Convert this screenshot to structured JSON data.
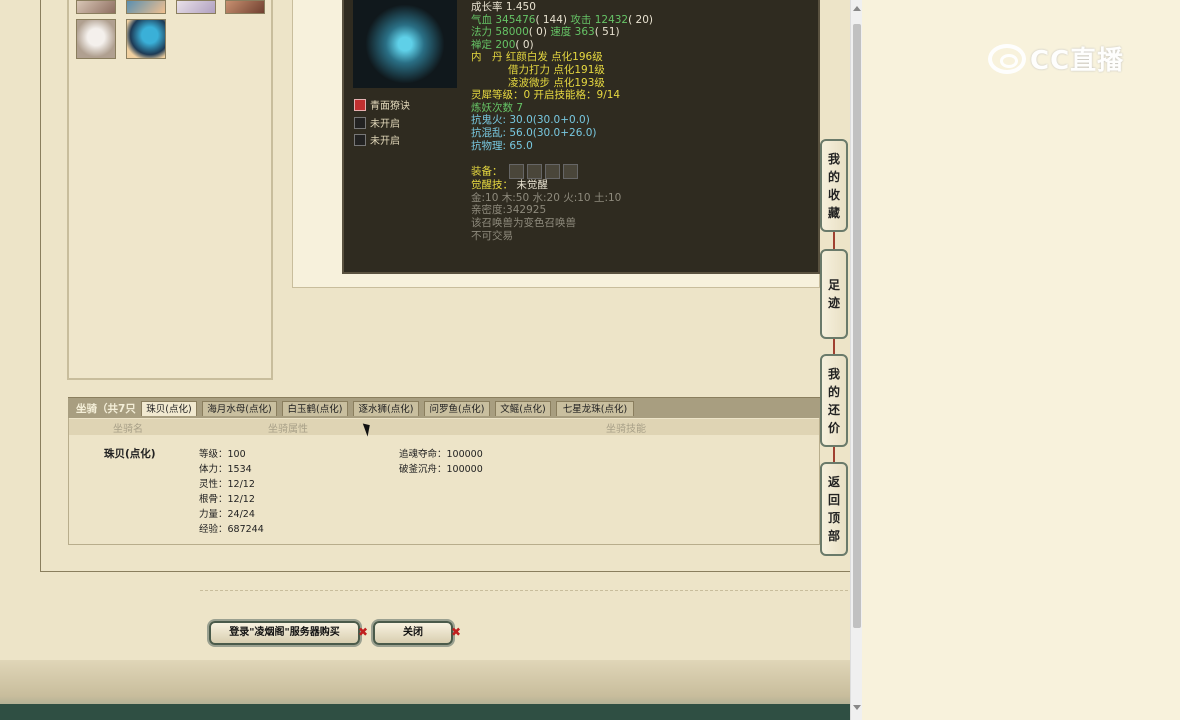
{
  "pet": {
    "stats": {
      "growth": "成长率 1.450",
      "hp_label": "气血",
      "hp_value": "345476",
      "hp_extra": "( 144)",
      "atk_label": "攻击",
      "atk_value": "12432",
      "atk_extra": "( 20)",
      "mp_label": "法力",
      "mp_value": "58000",
      "mp_extra": "( 0)",
      "spd_label": "速度",
      "spd_value": "363",
      "spd_extra": "( 51)",
      "def_label": "禅定",
      "def_value": "200",
      "def_extra": "( 0)",
      "neidan_label": "内　丹",
      "neidan1": "红颜白发 点化196级",
      "neidan2": "借力打力 点化191级",
      "neidan3": "凌波微步 点化193级",
      "lingxi": "灵犀等级：0 开启技能格：9/14",
      "lianyao": "炼妖次数 7",
      "kanghuo": "抗鬼火: 30.0(30.0+0.0)",
      "kanghunluan": "抗混乱: 56.0(30.0+26.0)",
      "kangwuli": "抗物理: 65.0",
      "equip_label": "装备：",
      "awaken_label": "觉醒技：",
      "awaken_value": "未觉醒",
      "elements": "金:10 木:50 水:20 火:10 土:10",
      "intimacy": "亲密度:342925",
      "bianse": "该召唤兽为变色召唤兽",
      "tradable": "不可交易"
    },
    "skills": [
      {
        "label": "青面獠诀"
      },
      {
        "label": "未开启"
      },
      {
        "label": "未开启"
      }
    ]
  },
  "mount": {
    "title": "坐骑（共7只",
    "tabs": [
      "珠贝(点化)",
      "海月水母(点化)",
      "白玉鹤(点化)",
      "逐水狮(点化)",
      "问罗鱼(点化)",
      "文鳐(点化)",
      "七星龙珠(点化)"
    ],
    "headers": {
      "name": "坐骑名",
      "attr": "坐骑属性",
      "skill": "坐骑技能"
    },
    "name": "珠贝(点化)",
    "attrs": [
      "等级：100",
      "体力：1534",
      "灵性：12/12",
      "根骨：12/12",
      "力量：24/24",
      "经验：687244"
    ],
    "skills": [
      "追魂夺命：100000",
      "破釜沉舟：100000"
    ]
  },
  "buttons": {
    "buy": "登录\"凌烟阁\"服务器购买",
    "close": "关闭"
  },
  "side_nav": [
    {
      "label": "我的收藏",
      "chars": [
        "我",
        "的",
        "收",
        "藏"
      ]
    },
    {
      "label": "足迹",
      "chars": [
        "足",
        "迹"
      ]
    },
    {
      "label": "我的还价",
      "chars": [
        "我",
        "的",
        "还",
        "价"
      ]
    },
    {
      "label": "返回顶部",
      "chars": [
        "返",
        "回",
        "顶",
        "部"
      ]
    }
  ],
  "logo": {
    "text": "CC直播"
  }
}
